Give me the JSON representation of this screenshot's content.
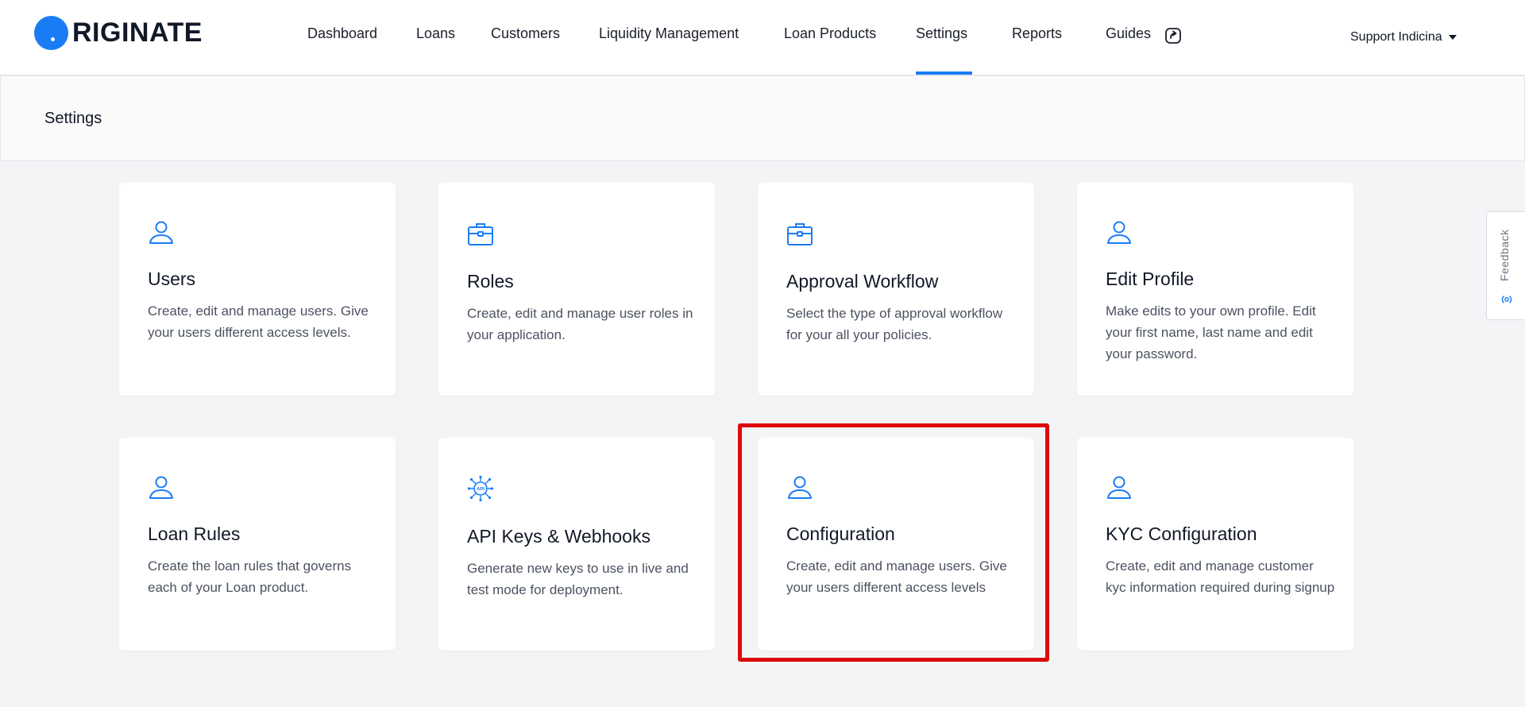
{
  "brand": {
    "logo_text": "RIGINATE",
    "accent": "#1a7cf5"
  },
  "nav": {
    "items": [
      {
        "label": "Dashboard"
      },
      {
        "label": "Loans"
      },
      {
        "label": "Customers"
      },
      {
        "label": "Liquidity Management"
      },
      {
        "label": "Loan Products"
      },
      {
        "label": "Settings",
        "active": true
      },
      {
        "label": "Reports"
      },
      {
        "label": "Guides",
        "icon": "external-link-icon"
      }
    ],
    "user": "Support Indicina"
  },
  "page": {
    "title": "Settings"
  },
  "cards": [
    {
      "title": "Users",
      "description": "Create, edit and manage users. Give your users different access levels.",
      "icon": "user-icon"
    },
    {
      "title": "Roles",
      "description": "Create, edit and manage user roles in your application.",
      "icon": "briefcase-icon"
    },
    {
      "title": "Approval Workflow",
      "description": "Select the type of approval workflow for your all your policies.",
      "icon": "briefcase-icon"
    },
    {
      "title": "Edit Profile",
      "description": "Make edits to your own profile. Edit your first name, last name and edit your password.",
      "icon": "user-icon"
    },
    {
      "title": "Loan Rules",
      "description": "Create the loan rules that governs each of your Loan product.",
      "icon": "user-icon"
    },
    {
      "title": "API Keys & Webhooks",
      "description": "Generate new keys to use in live and test mode for deployment.",
      "icon": "api-icon"
    },
    {
      "title": "Configuration",
      "description": "Create, edit and manage users. Give your users different access levels",
      "icon": "user-icon",
      "highlighted": true
    },
    {
      "title": "KYC Configuration",
      "description": "Create, edit and manage customer kyc information required during signup",
      "icon": "user-icon"
    }
  ],
  "feedback": {
    "label": "Feedback"
  },
  "colors": {
    "highlight": "#dc0b0b",
    "background": "#f3f4f6"
  }
}
